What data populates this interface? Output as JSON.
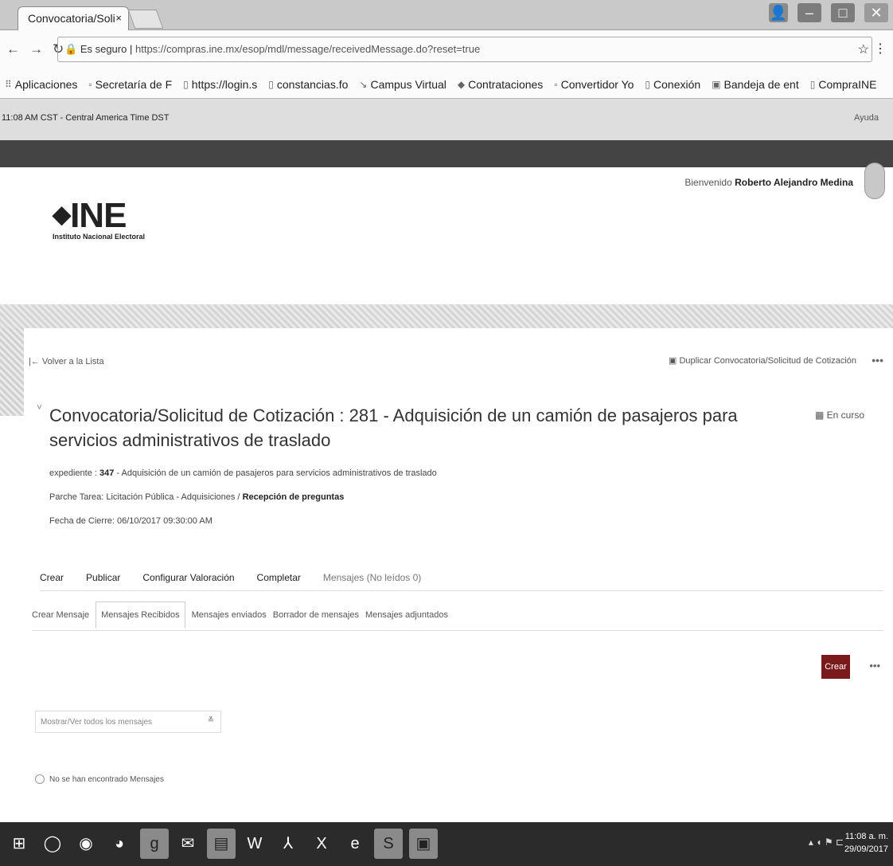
{
  "browser": {
    "tab_title": "Convocatoria/Soli",
    "tab_close": "×",
    "secure_label": "Es seguro",
    "url": "https://compras.ine.mx/esop/mdl/message/receivedMessage.do?reset=true",
    "bookmarks": [
      "Aplicaciones",
      "Secretaría de F",
      "https://login.s",
      "constancias.fo",
      "Campus Virtual",
      "Contrataciones",
      "Convertidor Yo",
      "Conexión",
      "Bandeja de ent",
      "CompraINE"
    ]
  },
  "topinfo": {
    "clock": "11:08 AM CST - Central America Time DST",
    "help": "Ayuda"
  },
  "header": {
    "welcome_prefix": "Bienvenido",
    "user_name": "Roberto Alejandro Medina",
    "logo_text": "INE",
    "logo_sub": "Instituto Nacional Electoral"
  },
  "content": {
    "back_label": "Volver a la Lista",
    "duplicate_label": "Duplicar Convocatoria/Solicitud de Cotización",
    "title": "Convocatoria/Solicitud de Cotización : 281 - Adquisición de un camión de pasajeros para servicios administrativos de traslado",
    "status": "En curso",
    "expediente_label": "expediente :",
    "expediente_number": "347",
    "expediente_desc": "- Adquisición de un camión de pasajeros para servicios administrativos de traslado",
    "tarea_label": "Parche Tarea: Licitación Pública - Adquisiciones /",
    "tarea_value": "Recepción de preguntas",
    "cierre": "Fecha de Cierre: 06/10/2017 09:30:00 AM"
  },
  "tabs1": [
    "Crear",
    "Publicar",
    "Configurar Valoración",
    "Completar",
    "Mensajes (No leídos 0)"
  ],
  "tabs2": [
    "Crear Mensaje",
    "Mensajes Recibidos",
    "Mensajes enviados",
    "Borrador de mensajes",
    "Mensajes adjuntados"
  ],
  "create_button": "Crear",
  "filter_placeholder": "Mostrar/Ver todos los mensajes",
  "empty_message": "No se han encontrado Mensajes",
  "taskbar": {
    "time": "11:08 a. m.",
    "date": "29/09/2017"
  }
}
